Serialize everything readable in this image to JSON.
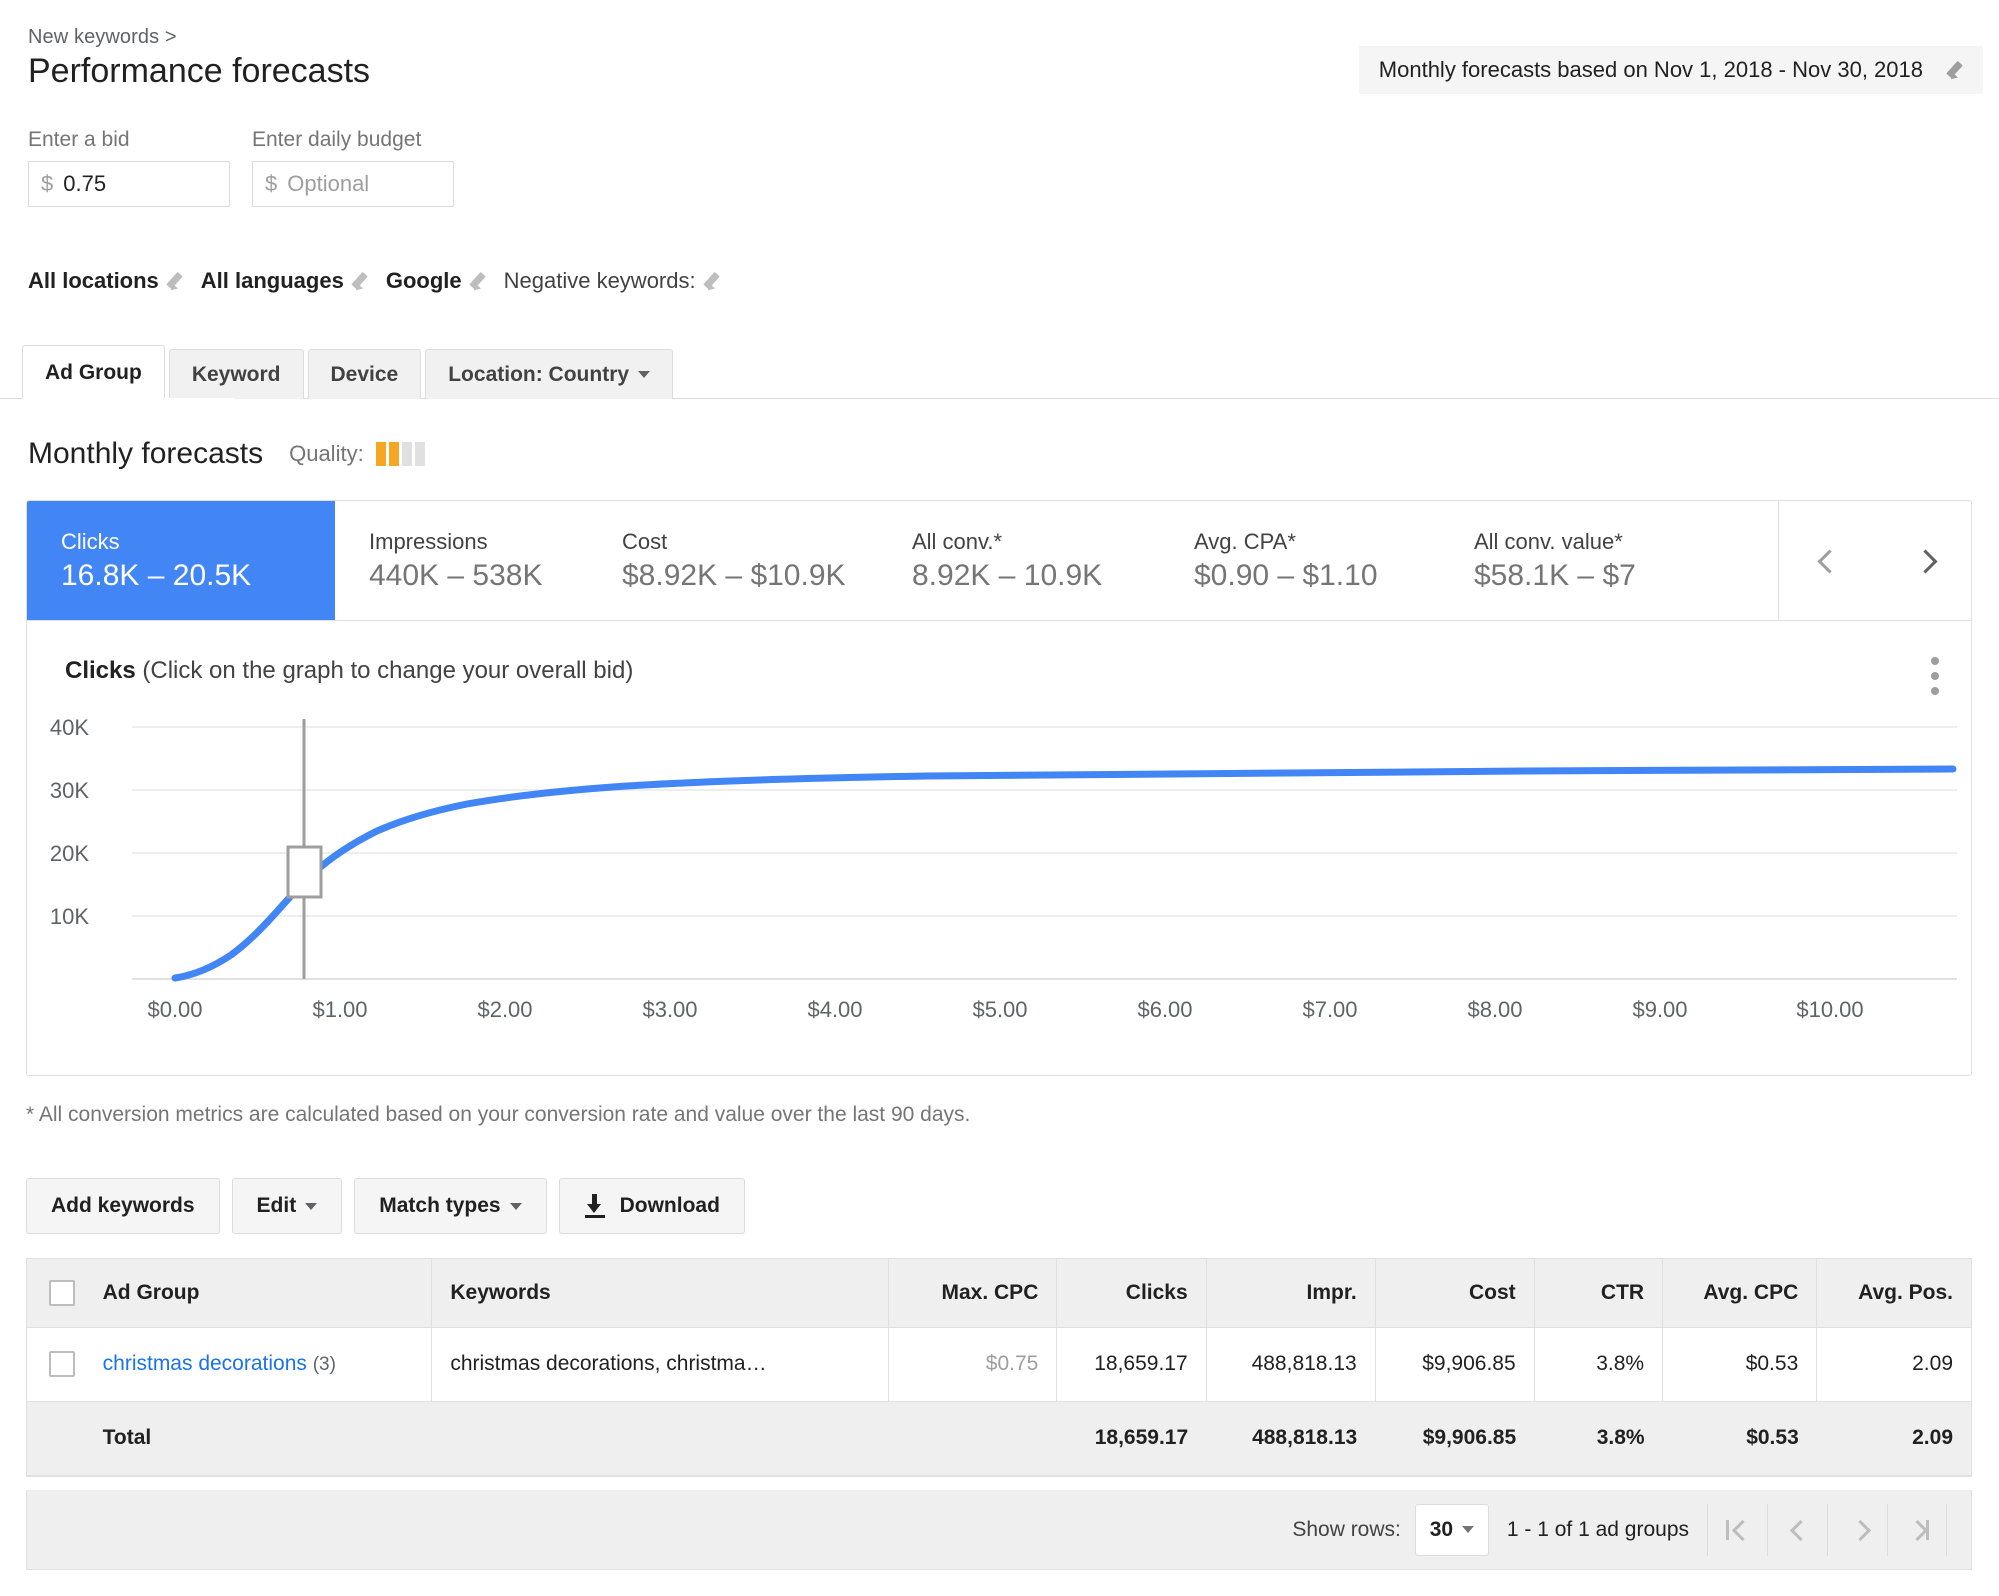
{
  "header": {
    "breadcrumb": "New keywords >",
    "title": "Performance forecasts",
    "daterange_text": "Monthly forecasts based on Nov 1, 2018 - Nov 30, 2018"
  },
  "bid": {
    "label": "Enter a bid",
    "currency": "$",
    "value": "0.75"
  },
  "budget": {
    "label": "Enter daily budget",
    "currency": "$",
    "placeholder": "Optional"
  },
  "settings": [
    {
      "label": "All locations",
      "strong": true
    },
    {
      "label": "All languages",
      "strong": true
    },
    {
      "label": "Google",
      "strong": true
    },
    {
      "label": "Negative keywords:",
      "strong": false
    }
  ],
  "tabs": [
    {
      "label": "Ad Group",
      "active": true,
      "caret": false
    },
    {
      "label": "Keyword",
      "active": false,
      "caret": false
    },
    {
      "label": "Device",
      "active": false,
      "caret": false
    },
    {
      "label": "Location: Country",
      "active": false,
      "caret": true
    }
  ],
  "section": {
    "title": "Monthly forecasts",
    "quality_label": "Quality:",
    "quality_filled": 2,
    "quality_total": 4,
    "quality_color": "#f5a623"
  },
  "metrics": [
    {
      "name": "Clicks",
      "value": "16.8K – 20.5K",
      "selected": true
    },
    {
      "name": "Impressions",
      "value": "440K – 538K",
      "selected": false
    },
    {
      "name": "Cost",
      "value": "$8.92K – $10.9K",
      "selected": false
    },
    {
      "name": "All conv.*",
      "value": "8.92K – 10.9K",
      "selected": false
    },
    {
      "name": "Avg. CPA*",
      "value": "$0.90 – $1.10",
      "selected": false
    },
    {
      "name": "All conv. value*",
      "value": "$58.1K – $7",
      "selected": false
    }
  ],
  "metric_nav": {
    "prev": "‹",
    "next": "›"
  },
  "chart": {
    "title_bold": "Clicks",
    "title_rest": " (Click on the graph to change your overall bid)",
    "menu": "more-options"
  },
  "chart_data": {
    "type": "line",
    "title": "Clicks (Click on the graph to change your overall bid)",
    "xlabel": "",
    "ylabel": "",
    "xlim": [
      0,
      10.9
    ],
    "ylim": [
      0,
      44000
    ],
    "grid": true,
    "legend": false,
    "xtick_labels": [
      "$0.00",
      "$1.00",
      "$2.00",
      "$3.00",
      "$4.00",
      "$5.00",
      "$6.00",
      "$7.00",
      "$8.00",
      "$9.00",
      "$10.00"
    ],
    "xticks": [
      0,
      1,
      2,
      3,
      4,
      5,
      6,
      7,
      8,
      9,
      10
    ],
    "ytick_labels": [
      "10K",
      "20K",
      "30K",
      "40K"
    ],
    "yticks": [
      10000,
      20000,
      30000,
      40000
    ],
    "line_color": "#4285f4",
    "marker": {
      "x": 0.75,
      "y": 21500,
      "label": "current bid handle"
    },
    "series": [
      {
        "name": "Clicks",
        "x": [
          0.0,
          0.1,
          0.2,
          0.3,
          0.4,
          0.5,
          0.6,
          0.7,
          0.75,
          0.8,
          0.9,
          1.0,
          1.2,
          1.4,
          1.6,
          1.8,
          2.0,
          2.4,
          2.8,
          3.2,
          3.6,
          4.0,
          5.0,
          6.0,
          7.0,
          8.0,
          9.0,
          10.0,
          10.9
        ],
        "values": [
          600,
          1400,
          3000,
          5600,
          8800,
          12200,
          15600,
          18700,
          20200,
          21500,
          23500,
          25200,
          27300,
          28600,
          29500,
          30000,
          30400,
          30900,
          31200,
          31400,
          31550,
          31650,
          31850,
          31950,
          32020,
          32080,
          32130,
          32180,
          32220
        ]
      }
    ]
  },
  "footnote": "* All conversion metrics are calculated based on your conversion rate and value over the last 90 days.",
  "toolbar": [
    {
      "label": "Add keywords",
      "caret": false,
      "icon": ""
    },
    {
      "label": "Edit",
      "caret": true,
      "icon": ""
    },
    {
      "label": "Match types",
      "caret": true,
      "icon": ""
    },
    {
      "label": "Download",
      "caret": false,
      "icon": "download-icon"
    }
  ],
  "table": {
    "columns": [
      "Ad Group",
      "Keywords",
      "Max. CPC",
      "Clicks",
      "Impr.",
      "Cost",
      "CTR",
      "Avg. CPC",
      "Avg. Pos."
    ],
    "rows": [
      {
        "ad_group": "christmas decorations",
        "ad_group_count": "(3)",
        "keywords": "christmas decorations, christma…",
        "max_cpc": "$0.75",
        "clicks": "18,659.17",
        "impr": "488,818.13",
        "cost": "$9,906.85",
        "ctr": "3.8%",
        "avg_cpc": "$0.53",
        "avg_pos": "2.09"
      }
    ],
    "total": {
      "label": "Total",
      "max_cpc": "",
      "clicks": "18,659.17",
      "impr": "488,818.13",
      "cost": "$9,906.85",
      "ctr": "3.8%",
      "avg_cpc": "$0.53",
      "avg_pos": "2.09"
    }
  },
  "pagination": {
    "show_rows_label": "Show rows:",
    "rows_value": "30",
    "range_text": "1 - 1 of 1 ad groups"
  }
}
